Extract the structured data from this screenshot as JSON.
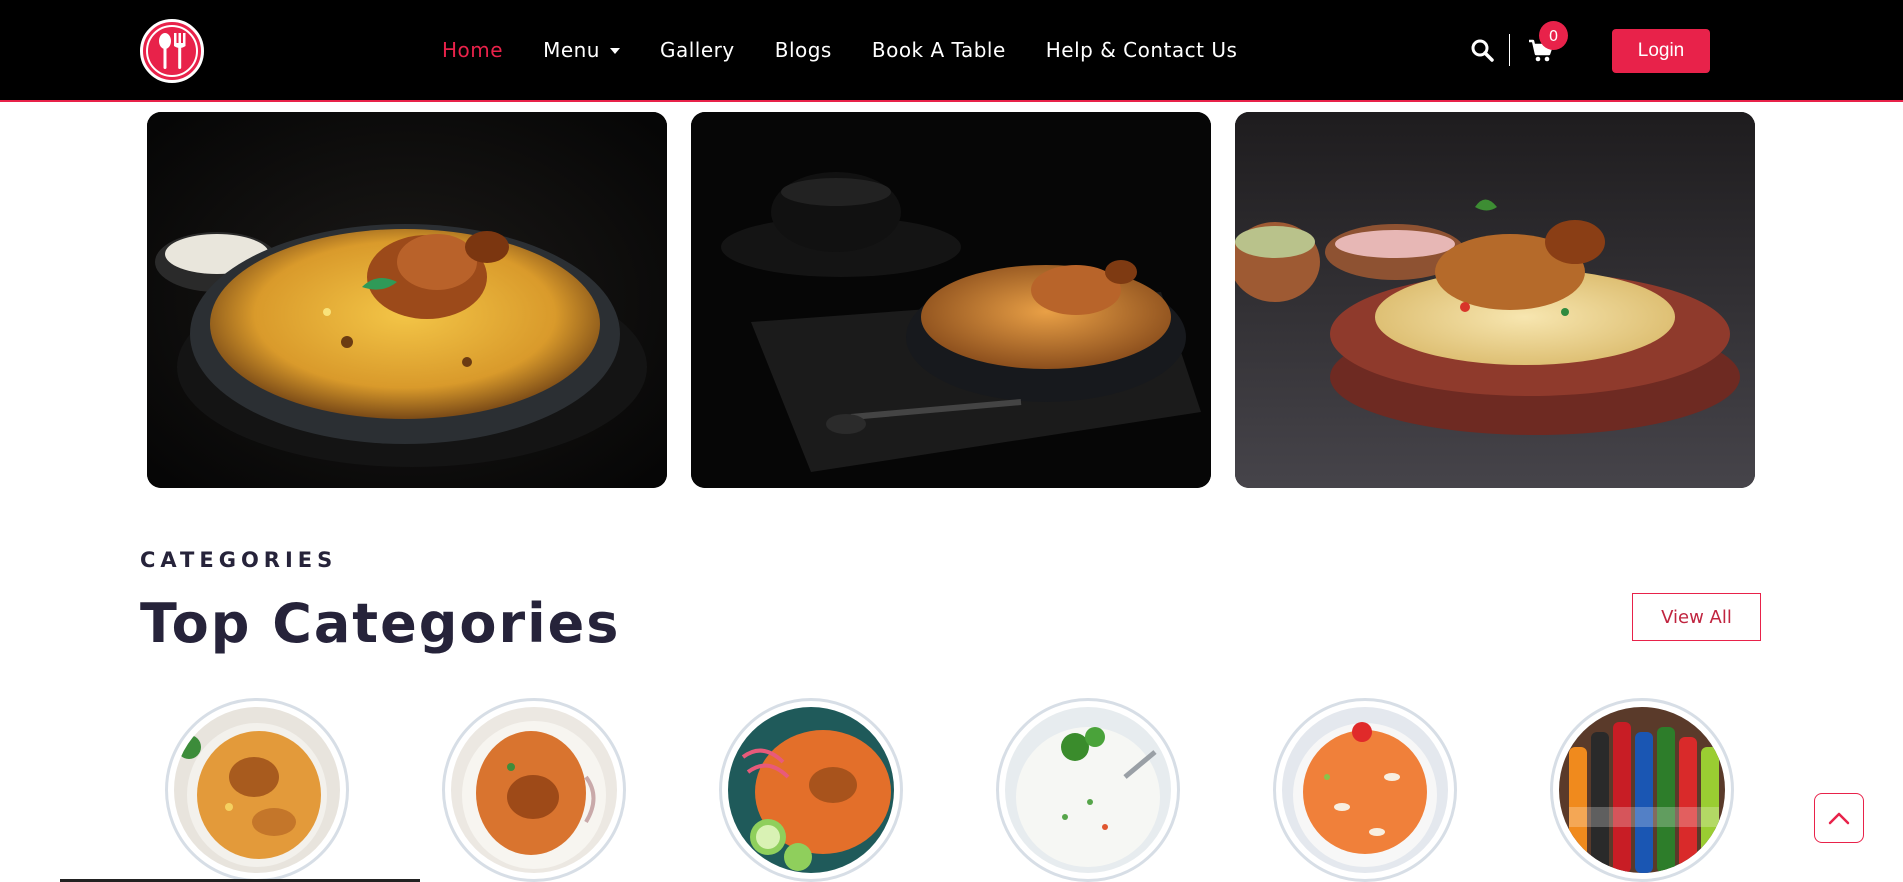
{
  "header": {
    "logo": "fork-spoon-logo",
    "nav": [
      {
        "label": "Home",
        "active": true
      },
      {
        "label": "Menu",
        "dropdown": true
      },
      {
        "label": "Gallery"
      },
      {
        "label": "Blogs"
      },
      {
        "label": "Book A Table"
      },
      {
        "label": "Help & Contact Us"
      }
    ],
    "cart_count": "0",
    "login_label": "Login"
  },
  "hero": {
    "images": [
      "biryani-plate-image",
      "biryani-bowl-image",
      "biryani-clay-dish-image"
    ]
  },
  "categories": {
    "eyebrow": "CATEGORIES",
    "title": "Top Categories",
    "view_all_label": "View All",
    "items": [
      "biryani-image",
      "biryani-image",
      "biryani-salad-image",
      "raita-image",
      "sweet-rice-image",
      "soft-drinks-image"
    ]
  },
  "colors": {
    "accent": "#e8224a",
    "header_bg": "#000000",
    "heading": "#26233a"
  }
}
